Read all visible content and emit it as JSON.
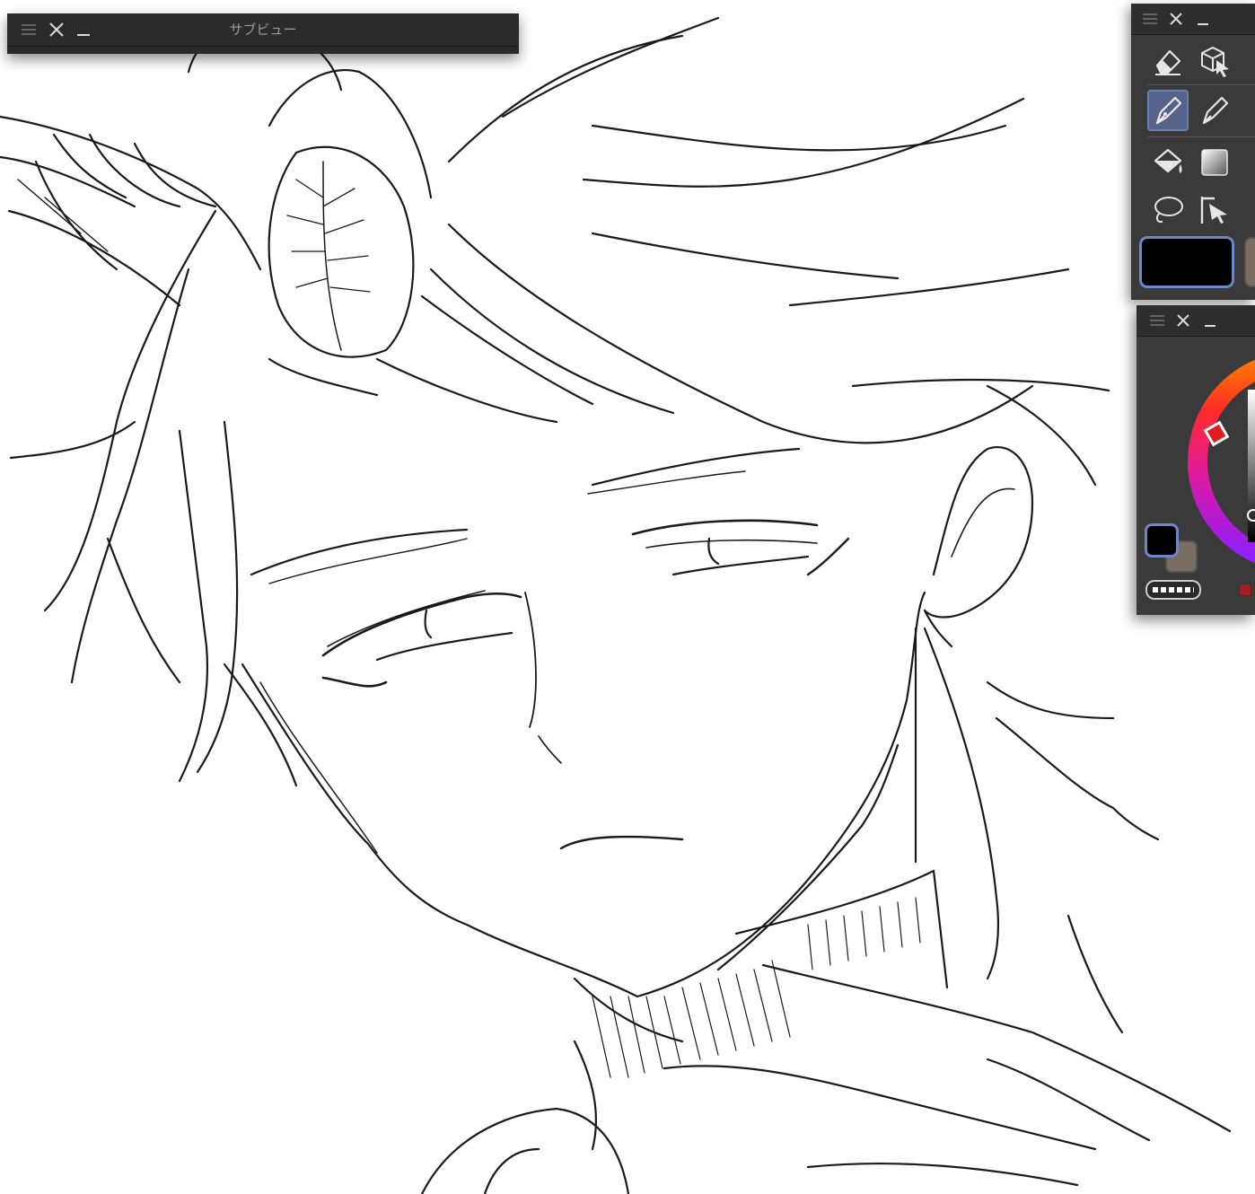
{
  "subview": {
    "title": "サブビュー"
  },
  "tool_palette": {
    "tools": [
      {
        "name": "eraser-icon"
      },
      {
        "name": "object-select-icon"
      },
      {
        "name": "pen-icon",
        "selected": true
      },
      {
        "name": "pencil-icon"
      },
      {
        "name": "fill-icon"
      },
      {
        "name": "gradient-icon"
      },
      {
        "name": "lasso-icon"
      },
      {
        "name": "operation-icon"
      }
    ],
    "active_color": "#000000"
  },
  "color_panel": {
    "main_color": "#000000",
    "sub_color": "#7a6e62",
    "accent": "#6d86c4"
  },
  "colors": {
    "panel_bg": "#3a3a3a",
    "titlebar": "#2b2b2b",
    "selection": "#55628a"
  }
}
